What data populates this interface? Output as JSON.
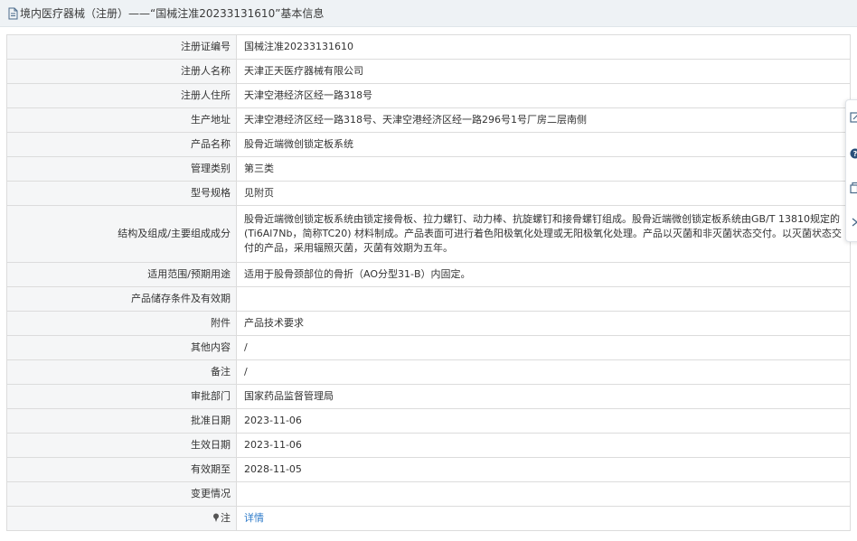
{
  "header": {
    "title": "境内医疗器械（注册）——“国械注准20233131610”基本信息"
  },
  "rows": [
    {
      "label": "注册证编号",
      "value": "国械注准20233131610"
    },
    {
      "label": "注册人名称",
      "value": "天津正天医疗器械有限公司"
    },
    {
      "label": "注册人住所",
      "value": "天津空港经济区经一路318号"
    },
    {
      "label": "生产地址",
      "value": "天津空港经济区经一路318号、天津空港经济区经一路296号1号厂房二层南侧"
    },
    {
      "label": "产品名称",
      "value": "股骨近端微创锁定板系统"
    },
    {
      "label": "管理类别",
      "value": "第三类"
    },
    {
      "label": "型号规格",
      "value": "见附页"
    },
    {
      "label": "结构及组成/主要组成成分",
      "value": "股骨近端微创锁定板系统由锁定接骨板、拉力螺钉、动力棒、抗旋螺钉和接骨螺钉组成。股骨近端微创锁定板系统由GB/T 13810规定的(Ti6Al7Nb，简称TC20) 材料制成。产品表面可进行着色阳极氧化处理或无阳极氧化处理。产品以灭菌和非灭菌状态交付。以灭菌状态交付的产品，采用辐照灭菌，灭菌有效期为五年。"
    },
    {
      "label": "适用范围/预期用途",
      "value": "适用于股骨颈部位的骨折（AO分型31-B）内固定。"
    },
    {
      "label": "产品储存条件及有效期",
      "value": ""
    },
    {
      "label": "附件",
      "value": "产品技术要求"
    },
    {
      "label": "其他内容",
      "value": "/"
    },
    {
      "label": "备注",
      "value": "/"
    },
    {
      "label": "审批部门",
      "value": "国家药品监督管理局"
    },
    {
      "label": "批准日期",
      "value": "2023-11-06"
    },
    {
      "label": "生效日期",
      "value": "2023-11-06"
    },
    {
      "label": "有效期至",
      "value": "2028-11-05"
    },
    {
      "label": "变更情况",
      "value": ""
    }
  ],
  "note_row": {
    "label": "注",
    "link": "详情"
  },
  "float_bar": {
    "icons": [
      "edit-icon",
      "help-icon",
      "copy-icon",
      "collapse-icon"
    ]
  },
  "colors": {
    "header_bg": "#eef2f5",
    "label_bg": "#f5f6f7",
    "border": "#dcdcdc",
    "link": "#2c7ac9"
  }
}
